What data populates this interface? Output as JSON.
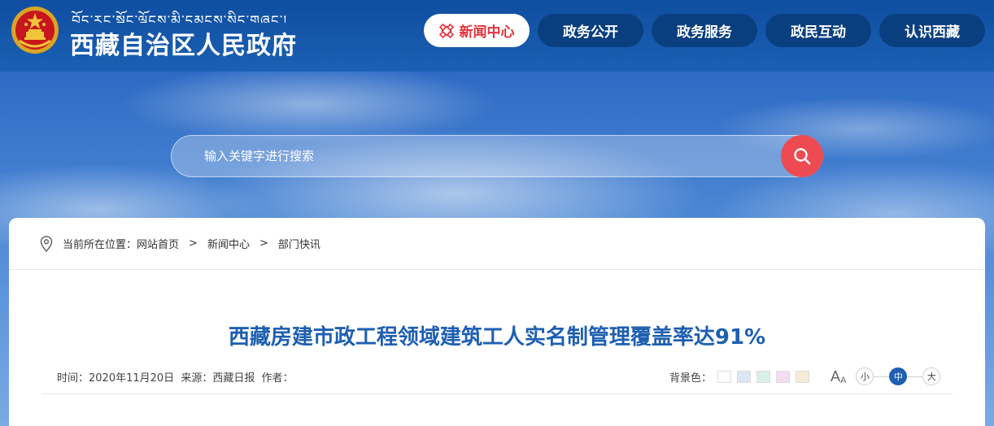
{
  "header": {
    "tibetan_name": "བོད་རང་སྐྱོང་ལྗོངས་མི་དམངས་སྲིད་གཞུང་།",
    "site_name": "西藏自治区人民政府",
    "emblem_icon": "national-emblem-icon"
  },
  "nav": {
    "items": [
      {
        "label": "新闻中心",
        "active": true
      },
      {
        "label": "政务公开",
        "active": false
      },
      {
        "label": "政务服务",
        "active": false
      },
      {
        "label": "政民互动",
        "active": false
      },
      {
        "label": "认识西藏",
        "active": false
      }
    ]
  },
  "search": {
    "placeholder": "输入关键字进行搜索",
    "icon": "search-icon"
  },
  "breadcrumb": {
    "prefix": "当前所在位置：",
    "items": [
      "网站首页",
      "新闻中心",
      "部门快讯"
    ],
    "separator": ">"
  },
  "article": {
    "title": "西藏房建市政工程领域建筑工人实名制管理覆盖率达91%",
    "time_label": "时间：",
    "time_value": "2020年11月20日",
    "source_label": "来源：",
    "source_value": "西藏日报",
    "author_label": "作者："
  },
  "reading_tools": {
    "bg_label": "背景色：",
    "bg_colors": [
      "#ffffff",
      "#dde7f4",
      "#d8f0e5",
      "#f3ddf0",
      "#f5ecd5"
    ],
    "font_sizes": [
      {
        "label": "小",
        "active": false
      },
      {
        "label": "中",
        "active": true
      },
      {
        "label": "大",
        "active": false
      }
    ]
  },
  "colors": {
    "header_blue": "#0f4ea0",
    "nav_dark": "#0a3f7f",
    "accent_red": "#e2343b",
    "title_blue": "#1e5fb1"
  }
}
